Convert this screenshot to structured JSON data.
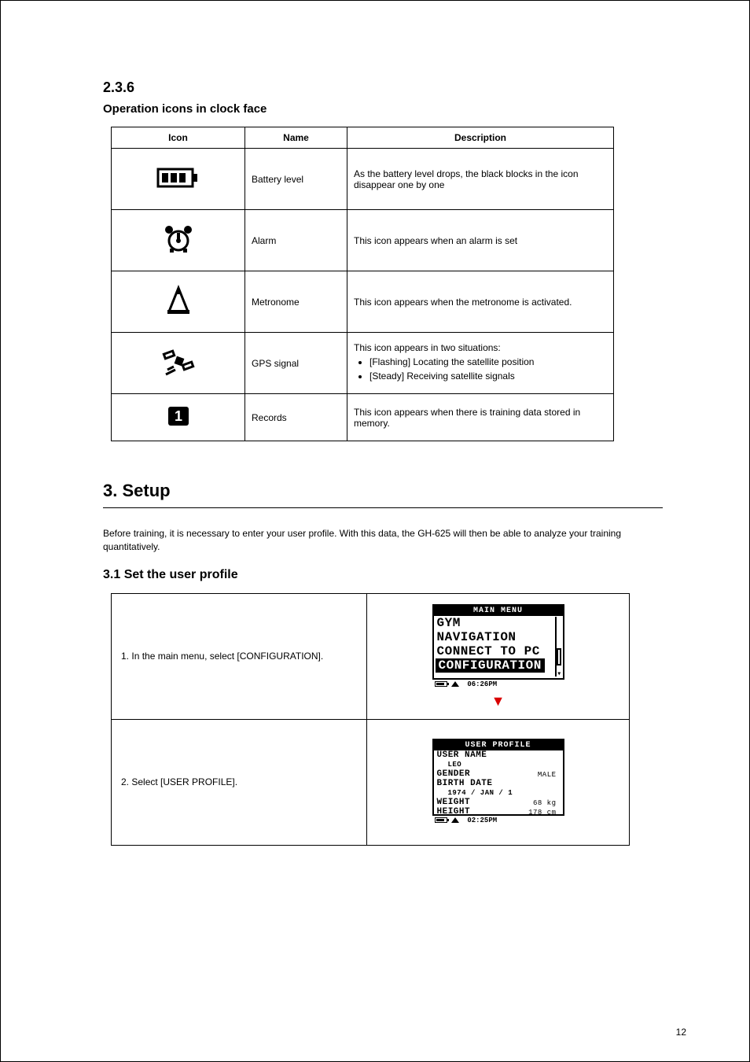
{
  "icon_subsection": {
    "number": "2.3.6",
    "title": "Operation icons in clock face",
    "table": {
      "headers": {
        "icon": "Icon",
        "name": "Name",
        "desc": "Description"
      },
      "rows": [
        {
          "iconName": "battery-icon",
          "name": "Battery level",
          "desc": "As the battery level drops, the black blocks in the icon disappear one by one"
        },
        {
          "iconName": "alarm-clock-icon",
          "name": "Alarm",
          "desc": "This icon appears when an alarm is set"
        },
        {
          "iconName": "metronome-icon",
          "name": "Metronome",
          "desc": "This icon appears when the metronome is activated."
        },
        {
          "iconName": "satellite-icon",
          "name": "GPS signal",
          "desc_intro": "This icon appears in two situations:",
          "bullets": [
            "[Flashing] Locating the satellite position",
            "[Steady] Receiving satellite signals"
          ]
        },
        {
          "iconName": "1inbox-icon",
          "name": "Records",
          "desc": "This icon appears when there is training data stored in memory."
        }
      ]
    }
  },
  "chapter3": {
    "title": "3. Setup",
    "intro": "Before training, it is necessary to enter your user profile. With this data, the GH-625 will then be able to analyze your training quantitatively.",
    "subsection": "3.1 Set the user profile",
    "steps": [
      {
        "num": "1.",
        "text": "In the main menu, select [CONFIGURATION].",
        "screen": {
          "title": "MAIN MENU",
          "lines": [
            "GYM",
            "NAVIGATION",
            "CONNECT TO PC"
          ],
          "selected": "CONFIGURATION",
          "status_time": "06:26PM"
        }
      },
      {
        "num": "2.",
        "text": "Select [USER PROFILE].",
        "screen": {
          "title": "USER PROFILE",
          "fields": {
            "user_name_label": "USER NAME",
            "user_name_value": "LEO",
            "gender_label": "GENDER",
            "gender_value": "MALE",
            "birth_label": "BIRTH DATE",
            "birth_value": "1974 / JAN /  1",
            "weight_label": "WEIGHT",
            "weight_value": "68 kg",
            "height_label": "HEIGHT",
            "height_value": "178 cm"
          },
          "status_time": "02:25PM"
        }
      }
    ]
  },
  "page_number": "12"
}
